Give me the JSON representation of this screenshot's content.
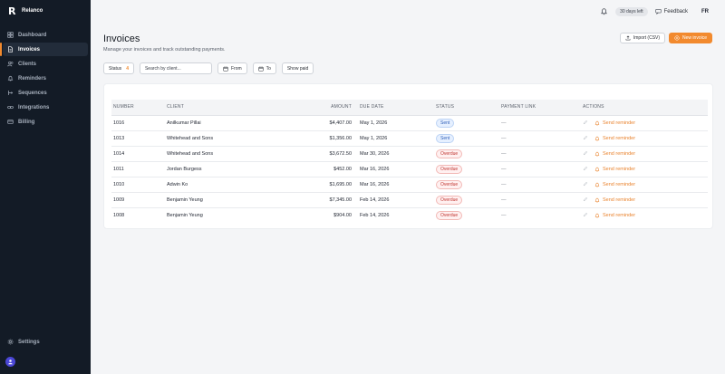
{
  "brand": {
    "mark": "R",
    "name": "Relanco"
  },
  "sidebar": {
    "items": [
      {
        "label": "Dashboard",
        "icon": "grid-icon",
        "active": false
      },
      {
        "label": "Invoices",
        "icon": "file-icon",
        "active": true
      },
      {
        "label": "Clients",
        "icon": "users-icon",
        "active": false
      },
      {
        "label": "Reminders",
        "icon": "bell-icon",
        "active": false
      },
      {
        "label": "Sequences",
        "icon": "sequence-icon",
        "active": false
      },
      {
        "label": "Integrations",
        "icon": "link-icon",
        "active": false
      },
      {
        "label": "Billing",
        "icon": "card-icon",
        "active": false
      }
    ],
    "settings_label": "Settings"
  },
  "topbar": {
    "trial_badge": "30 days left",
    "feedback_label": "Feedback",
    "language": "FR"
  },
  "page": {
    "title": "Invoices",
    "subtitle": "Manage your invoices and track outstanding payments."
  },
  "actions": {
    "import_label": "Import (CSV)",
    "new_label": "New invoice"
  },
  "filters": {
    "status_label": "Status",
    "status_count": "4",
    "search_placeholder": "Search by client...",
    "from_label": "From",
    "to_label": "To",
    "show_paid_label": "Show paid"
  },
  "table": {
    "headers": {
      "number": "NUMBER",
      "client": "CLIENT",
      "amount": "AMOUNT",
      "due_date": "DUE DATE",
      "status": "STATUS",
      "payment_link": "PAYMENT LINK",
      "actions": "ACTIONS"
    },
    "reminder_label": "Send reminder",
    "rows": [
      {
        "number": "1016",
        "client": "Anilkumar Pillai",
        "amount": "$4,407.00",
        "due": "May 1, 2026",
        "status": "Sent",
        "link": "—"
      },
      {
        "number": "1013",
        "client": "Whitehead and Sons",
        "amount": "$1,356.00",
        "due": "May 1, 2026",
        "status": "Sent",
        "link": "—"
      },
      {
        "number": "1014",
        "client": "Whitehead and Sons",
        "amount": "$3,672.50",
        "due": "Mar 30, 2026",
        "status": "Overdue",
        "link": "—"
      },
      {
        "number": "1011",
        "client": "Jordan Burgess",
        "amount": "$452.00",
        "due": "Mar 16, 2026",
        "status": "Overdue",
        "link": "—"
      },
      {
        "number": "1010",
        "client": "Adwin Ko",
        "amount": "$1,695.00",
        "due": "Mar 16, 2026",
        "status": "Overdue",
        "link": "—"
      },
      {
        "number": "1009",
        "client": "Benjamin Yeung",
        "amount": "$7,345.00",
        "due": "Feb 14, 2026",
        "status": "Overdue",
        "link": "—"
      },
      {
        "number": "1008",
        "client": "Benjamin Yeung",
        "amount": "$904.00",
        "due": "Feb 14, 2026",
        "status": "Overdue",
        "link": "—"
      }
    ]
  },
  "colors": {
    "sidebar_bg": "#131b26",
    "accent": "#f28a2e",
    "sent": "#2f5fb8",
    "overdue": "#c0342f"
  }
}
